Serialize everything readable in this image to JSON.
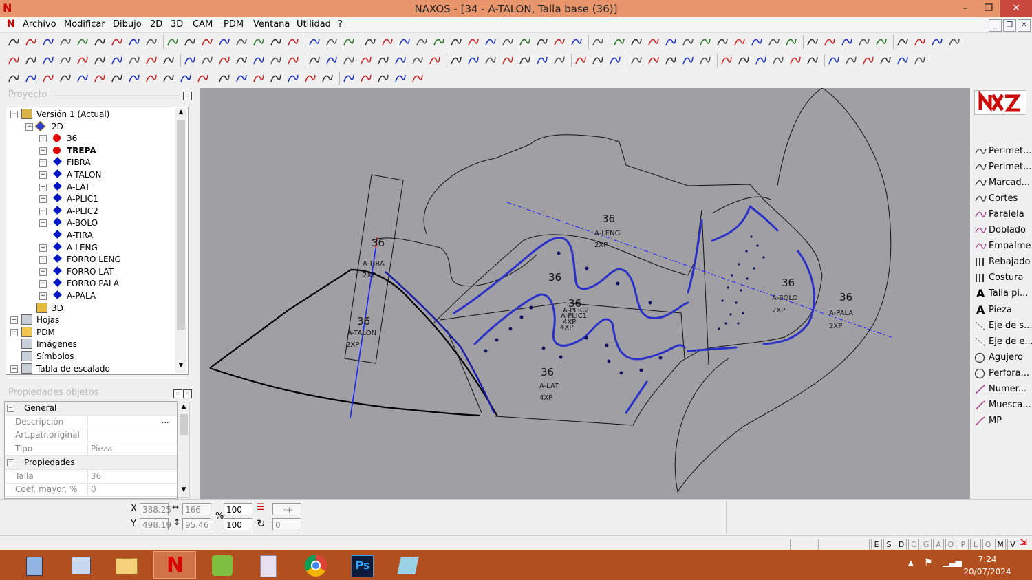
{
  "window": {
    "title": "NAXOS - [34 - A-TALON, Talla base (36)]",
    "logo": "N",
    "minimize": "–",
    "maximize": "❐",
    "close": "✕"
  },
  "menu": [
    "Archivo",
    "Modificar",
    "Dibujo",
    "2D",
    "3D",
    "CAM",
    "PDM",
    "Ventana",
    "Utilidad",
    "?"
  ],
  "project_panel": {
    "title": "Proyecto",
    "tree": [
      {
        "label": "Versión 1 (Actual)",
        "level": 0,
        "expander": "−",
        "icon": "version-icon"
      },
      {
        "label": "2D",
        "level": 1,
        "expander": "−",
        "icon": "diamond-icon"
      },
      {
        "label": "36",
        "level": 2,
        "expander": "+",
        "icon": "red-dot-icon"
      },
      {
        "label": "TREPA",
        "level": 2,
        "expander": "+",
        "icon": "red-dot-icon",
        "bold": true
      },
      {
        "label": "FIBRA",
        "level": 2,
        "expander": "+",
        "icon": "blue-diamond-icon"
      },
      {
        "label": "A-TALON",
        "level": 2,
        "expander": "+",
        "icon": "blue-diamond-icon"
      },
      {
        "label": "A-LAT",
        "level": 2,
        "expander": "+",
        "icon": "blue-diamond-icon"
      },
      {
        "label": "A-PLIC1",
        "level": 2,
        "expander": "+",
        "icon": "blue-diamond-icon"
      },
      {
        "label": "A-PLIC2",
        "level": 2,
        "expander": "+",
        "icon": "blue-diamond-icon"
      },
      {
        "label": "A-BOLO",
        "level": 2,
        "expander": "+",
        "icon": "blue-diamond-icon"
      },
      {
        "label": "A-TIRA",
        "level": 2,
        "expander": "",
        "icon": "blue-diamond-icon"
      },
      {
        "label": "A-LENG",
        "level": 2,
        "expander": "+",
        "icon": "blue-diamond-icon"
      },
      {
        "label": "FORRO LENG",
        "level": 2,
        "expander": "+",
        "icon": "blue-diamond-icon"
      },
      {
        "label": "FORRO LAT",
        "level": 2,
        "expander": "+",
        "icon": "blue-diamond-icon"
      },
      {
        "label": "FORRO PALA",
        "level": 2,
        "expander": "+",
        "icon": "blue-diamond-icon"
      },
      {
        "label": "A-PALA",
        "level": 2,
        "expander": "+",
        "icon": "blue-diamond-icon"
      },
      {
        "label": "3D",
        "level": 1,
        "expander": "",
        "icon": "cube-icon"
      },
      {
        "label": "Hojas",
        "level": 0,
        "expander": "+",
        "icon": "sheets-icon"
      },
      {
        "label": "PDM",
        "level": 0,
        "expander": "+",
        "icon": "folder-icon"
      },
      {
        "label": "Imágenes",
        "level": 0,
        "expander": "",
        "icon": "images-icon"
      },
      {
        "label": "Símbolos",
        "level": 0,
        "expander": "",
        "icon": "symbols-icon"
      },
      {
        "label": "Tabla de escalado",
        "level": 0,
        "expander": "+",
        "icon": "table-icon"
      }
    ]
  },
  "properties_panel": {
    "title": "Propiedades objetos",
    "rows": [
      {
        "type": "category",
        "name": "General"
      },
      {
        "type": "prop",
        "name": "Descripción",
        "value": "",
        "ellipsis": "..."
      },
      {
        "type": "prop",
        "name": "Art.patr.original",
        "value": ""
      },
      {
        "type": "prop",
        "name": "Tipo",
        "value": "Pieza"
      },
      {
        "type": "category",
        "name": "Propiedades"
      },
      {
        "type": "prop",
        "name": "Talla",
        "value": "36"
      },
      {
        "type": "prop",
        "name": "Coef. mayor. %",
        "value": "0"
      }
    ]
  },
  "canvas": {
    "labels": [
      {
        "id": "a-tira",
        "size": "36",
        "name": "A-TIRA",
        "qty": "2XP"
      },
      {
        "id": "a-talon",
        "size": "36",
        "name": "A-TALON",
        "qty": "2XP"
      },
      {
        "id": "a-leng",
        "size": "36",
        "name": "A-LENG",
        "qty": "2XP"
      },
      {
        "id": "a-plic2",
        "size": "36",
        "name": "A-PLIC2",
        "qty": "4XP"
      },
      {
        "id": "a-plic1",
        "size": "36",
        "name": "A-PLIC1",
        "qty": "4XP"
      },
      {
        "id": "a-lat",
        "size": "36",
        "name": "A-LAT",
        "qty": "4XP"
      },
      {
        "id": "a-bolo",
        "size": "36",
        "name": "A-BOLO",
        "qty": "2XP"
      },
      {
        "id": "a-pala",
        "size": "36",
        "name": "A-PALA",
        "qty": "2XP"
      }
    ],
    "extra_size_label": "36"
  },
  "palette": [
    {
      "label": "Perimet...",
      "icon": "curve-icon"
    },
    {
      "label": "Perimet...",
      "icon": "curve-icon"
    },
    {
      "label": "Marcad...",
      "icon": "curve-icon"
    },
    {
      "label": "Cortes",
      "icon": "curve-icon"
    },
    {
      "label": "Paralela",
      "icon": "parallel-icon"
    },
    {
      "label": "Doblado",
      "icon": "fold-icon"
    },
    {
      "label": "Empalme",
      "icon": "join-icon"
    },
    {
      "label": "Rebajado",
      "icon": "skive-icon"
    },
    {
      "label": "Costura",
      "icon": "seam-icon"
    },
    {
      "label": "Talla pi...",
      "icon": "text-a-icon"
    },
    {
      "label": "Pieza",
      "icon": "text-a-icon"
    },
    {
      "label": "Eje de s...",
      "icon": "axis-icon"
    },
    {
      "label": "Eje de e...",
      "icon": "axis-icon"
    },
    {
      "label": "Agujero",
      "icon": "circle-icon"
    },
    {
      "label": "Perfora...",
      "icon": "circle-icon"
    },
    {
      "label": "Numer...",
      "icon": "marker-icon"
    },
    {
      "label": "Muesca...",
      "icon": "marker-icon"
    },
    {
      "label": "MP",
      "icon": "marker-icon"
    }
  ],
  "coords": {
    "x_label": "X",
    "y_label": "Y",
    "x": "388.25",
    "y": "498.19",
    "width": "166",
    "height": "95.46",
    "scale_x": "100",
    "scale_y": "100",
    "percent": "%",
    "angle": "0"
  },
  "status_toggles": [
    "E",
    "S",
    "D",
    "C",
    "G",
    "A",
    "O",
    "P",
    "L",
    "Q",
    "M",
    "V"
  ],
  "status_active": [
    "E",
    "S",
    "D",
    "M",
    "V"
  ],
  "taskbar": {
    "apps": [
      "calculator-app",
      "file-manager-app",
      "explorer-app",
      "naxos-app",
      "plants-app",
      "paint-app",
      "chrome-app",
      "photoshop-app",
      "notes-app"
    ],
    "photoshop_label": "Ps",
    "time": "7:24",
    "date": "20/07/2024"
  }
}
